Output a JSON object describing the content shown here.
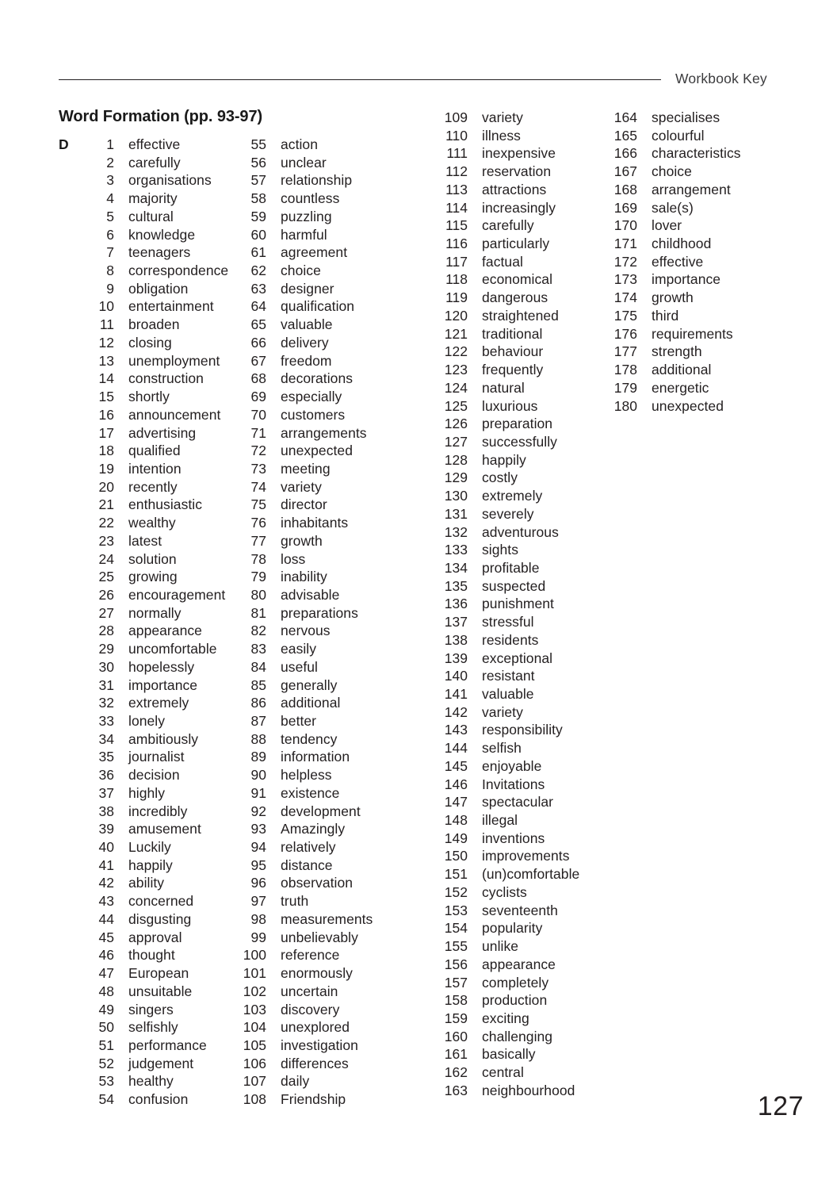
{
  "header": {
    "label": "Workbook Key"
  },
  "section": {
    "title": "Word Formation (pp. 93-97)",
    "exercise_letter": "D"
  },
  "page": {
    "number": "127"
  },
  "answers": {
    "column_1": [
      {
        "n": "1",
        "word": "effective"
      },
      {
        "n": "2",
        "word": "carefully"
      },
      {
        "n": "3",
        "word": "organisations"
      },
      {
        "n": "4",
        "word": "majority"
      },
      {
        "n": "5",
        "word": "cultural"
      },
      {
        "n": "6",
        "word": "knowledge"
      },
      {
        "n": "7",
        "word": "teenagers"
      },
      {
        "n": "8",
        "word": "correspondence"
      },
      {
        "n": "9",
        "word": "obligation"
      },
      {
        "n": "10",
        "word": "entertainment"
      },
      {
        "n": "11",
        "word": "broaden"
      },
      {
        "n": "12",
        "word": "closing"
      },
      {
        "n": "13",
        "word": "unemployment"
      },
      {
        "n": "14",
        "word": "construction"
      },
      {
        "n": "15",
        "word": "shortly"
      },
      {
        "n": "16",
        "word": "announcement"
      },
      {
        "n": "17",
        "word": "advertising"
      },
      {
        "n": "18",
        "word": "qualified"
      },
      {
        "n": "19",
        "word": "intention"
      },
      {
        "n": "20",
        "word": "recently"
      },
      {
        "n": "21",
        "word": "enthusiastic"
      },
      {
        "n": "22",
        "word": "wealthy"
      },
      {
        "n": "23",
        "word": "latest"
      },
      {
        "n": "24",
        "word": "solution"
      },
      {
        "n": "25",
        "word": "growing"
      },
      {
        "n": "26",
        "word": "encouragement"
      },
      {
        "n": "27",
        "word": "normally"
      },
      {
        "n": "28",
        "word": "appearance"
      },
      {
        "n": "29",
        "word": "uncomfortable"
      },
      {
        "n": "30",
        "word": "hopelessly"
      },
      {
        "n": "31",
        "word": "importance"
      },
      {
        "n": "32",
        "word": "extremely"
      },
      {
        "n": "33",
        "word": "lonely"
      },
      {
        "n": "34",
        "word": "ambitiously"
      },
      {
        "n": "35",
        "word": "journalist"
      },
      {
        "n": "36",
        "word": "decision"
      },
      {
        "n": "37",
        "word": "highly"
      },
      {
        "n": "38",
        "word": "incredibly"
      },
      {
        "n": "39",
        "word": "amusement"
      },
      {
        "n": "40",
        "word": "Luckily"
      },
      {
        "n": "41",
        "word": "happily"
      },
      {
        "n": "42",
        "word": "ability"
      },
      {
        "n": "43",
        "word": "concerned"
      },
      {
        "n": "44",
        "word": "disgusting"
      },
      {
        "n": "45",
        "word": "approval"
      },
      {
        "n": "46",
        "word": "thought"
      },
      {
        "n": "47",
        "word": "European"
      },
      {
        "n": "48",
        "word": "unsuitable"
      },
      {
        "n": "49",
        "word": "singers"
      },
      {
        "n": "50",
        "word": "selfishly"
      },
      {
        "n": "51",
        "word": "performance"
      },
      {
        "n": "52",
        "word": "judgement"
      },
      {
        "n": "53",
        "word": "healthy"
      },
      {
        "n": "54",
        "word": "confusion"
      }
    ],
    "column_2": [
      {
        "n": "55",
        "word": "action"
      },
      {
        "n": "56",
        "word": "unclear"
      },
      {
        "n": "57",
        "word": "relationship"
      },
      {
        "n": "58",
        "word": "countless"
      },
      {
        "n": "59",
        "word": "puzzling"
      },
      {
        "n": "60",
        "word": "harmful"
      },
      {
        "n": "61",
        "word": "agreement"
      },
      {
        "n": "62",
        "word": "choice"
      },
      {
        "n": "63",
        "word": "designer"
      },
      {
        "n": "64",
        "word": "qualification"
      },
      {
        "n": "65",
        "word": "valuable"
      },
      {
        "n": "66",
        "word": "delivery"
      },
      {
        "n": "67",
        "word": "freedom"
      },
      {
        "n": "68",
        "word": "decorations"
      },
      {
        "n": "69",
        "word": "especially"
      },
      {
        "n": "70",
        "word": "customers"
      },
      {
        "n": "71",
        "word": "arrangements"
      },
      {
        "n": "72",
        "word": "unexpected"
      },
      {
        "n": "73",
        "word": "meeting"
      },
      {
        "n": "74",
        "word": "variety"
      },
      {
        "n": "75",
        "word": "director"
      },
      {
        "n": "76",
        "word": "inhabitants"
      },
      {
        "n": "77",
        "word": "growth"
      },
      {
        "n": "78",
        "word": "loss"
      },
      {
        "n": "79",
        "word": "inability"
      },
      {
        "n": "80",
        "word": "advisable"
      },
      {
        "n": "81",
        "word": "preparations"
      },
      {
        "n": "82",
        "word": "nervous"
      },
      {
        "n": "83",
        "word": "easily"
      },
      {
        "n": "84",
        "word": "useful"
      },
      {
        "n": "85",
        "word": "generally"
      },
      {
        "n": "86",
        "word": "additional"
      },
      {
        "n": "87",
        "word": "better"
      },
      {
        "n": "88",
        "word": "tendency"
      },
      {
        "n": "89",
        "word": "information"
      },
      {
        "n": "90",
        "word": "helpless"
      },
      {
        "n": "91",
        "word": "existence"
      },
      {
        "n": "92",
        "word": "development"
      },
      {
        "n": "93",
        "word": "Amazingly"
      },
      {
        "n": "94",
        "word": "relatively"
      },
      {
        "n": "95",
        "word": "distance"
      },
      {
        "n": "96",
        "word": "observation"
      },
      {
        "n": "97",
        "word": "truth"
      },
      {
        "n": "98",
        "word": "measurements"
      },
      {
        "n": "99",
        "word": "unbelievably"
      },
      {
        "n": "100",
        "word": "reference"
      },
      {
        "n": "101",
        "word": "enormously"
      },
      {
        "n": "102",
        "word": "uncertain"
      },
      {
        "n": "103",
        "word": "discovery"
      },
      {
        "n": "104",
        "word": "unexplored"
      },
      {
        "n": "105",
        "word": "investigation"
      },
      {
        "n": "106",
        "word": "differences"
      },
      {
        "n": "107",
        "word": "daily"
      },
      {
        "n": "108",
        "word": "Friendship"
      }
    ],
    "column_3": [
      {
        "n": "109",
        "word": "variety"
      },
      {
        "n": "110",
        "word": "illness"
      },
      {
        "n": "111",
        "word": "inexpensive"
      },
      {
        "n": "112",
        "word": "reservation"
      },
      {
        "n": "113",
        "word": "attractions"
      },
      {
        "n": "114",
        "word": "increasingly"
      },
      {
        "n": "115",
        "word": "carefully"
      },
      {
        "n": "116",
        "word": "particularly"
      },
      {
        "n": "117",
        "word": "factual"
      },
      {
        "n": "118",
        "word": "economical"
      },
      {
        "n": "119",
        "word": "dangerous"
      },
      {
        "n": "120",
        "word": "straightened"
      },
      {
        "n": "121",
        "word": "traditional"
      },
      {
        "n": "122",
        "word": "behaviour"
      },
      {
        "n": "123",
        "word": "frequently"
      },
      {
        "n": "124",
        "word": "natural"
      },
      {
        "n": "125",
        "word": "luxurious"
      },
      {
        "n": "126",
        "word": "preparation"
      },
      {
        "n": "127",
        "word": "successfully"
      },
      {
        "n": "128",
        "word": "happily"
      },
      {
        "n": "129",
        "word": "costly"
      },
      {
        "n": "130",
        "word": "extremely"
      },
      {
        "n": "131",
        "word": "severely"
      },
      {
        "n": "132",
        "word": "adventurous"
      },
      {
        "n": "133",
        "word": "sights"
      },
      {
        "n": "134",
        "word": "profitable"
      },
      {
        "n": "135",
        "word": "suspected"
      },
      {
        "n": "136",
        "word": "punishment"
      },
      {
        "n": "137",
        "word": "stressful"
      },
      {
        "n": "138",
        "word": "residents"
      },
      {
        "n": "139",
        "word": "exceptional"
      },
      {
        "n": "140",
        "word": "resistant"
      },
      {
        "n": "141",
        "word": "valuable"
      },
      {
        "n": "142",
        "word": "variety"
      },
      {
        "n": "143",
        "word": "responsibility"
      },
      {
        "n": "144",
        "word": "selfish"
      },
      {
        "n": "145",
        "word": "enjoyable"
      },
      {
        "n": "146",
        "word": "Invitations"
      },
      {
        "n": "147",
        "word": "spectacular"
      },
      {
        "n": "148",
        "word": "illegal"
      },
      {
        "n": "149",
        "word": "inventions"
      },
      {
        "n": "150",
        "word": "improvements"
      },
      {
        "n": "151",
        "word": "(un)comfortable"
      },
      {
        "n": "152",
        "word": "cyclists"
      },
      {
        "n": "153",
        "word": "seventeenth"
      },
      {
        "n": "154",
        "word": "popularity"
      },
      {
        "n": "155",
        "word": "unlike"
      },
      {
        "n": "156",
        "word": "appearance"
      },
      {
        "n": "157",
        "word": "completely"
      },
      {
        "n": "158",
        "word": "production"
      },
      {
        "n": "159",
        "word": "exciting"
      },
      {
        "n": "160",
        "word": "challenging"
      },
      {
        "n": "161",
        "word": "basically"
      },
      {
        "n": "162",
        "word": "central"
      },
      {
        "n": "163",
        "word": "neighbourhood"
      }
    ],
    "column_4": [
      {
        "n": "164",
        "word": "specialises"
      },
      {
        "n": "165",
        "word": "colourful"
      },
      {
        "n": "166",
        "word": "characteristics"
      },
      {
        "n": "167",
        "word": "choice"
      },
      {
        "n": "168",
        "word": "arrangement"
      },
      {
        "n": "169",
        "word": "sale(s)"
      },
      {
        "n": "170",
        "word": "lover"
      },
      {
        "n": "171",
        "word": "childhood"
      },
      {
        "n": "172",
        "word": "effective"
      },
      {
        "n": "173",
        "word": "importance"
      },
      {
        "n": "174",
        "word": "growth"
      },
      {
        "n": "175",
        "word": "third"
      },
      {
        "n": "176",
        "word": "requirements"
      },
      {
        "n": "177",
        "word": "strength"
      },
      {
        "n": "178",
        "word": "additional"
      },
      {
        "n": "179",
        "word": "energetic"
      },
      {
        "n": "180",
        "word": "unexpected"
      }
    ]
  }
}
